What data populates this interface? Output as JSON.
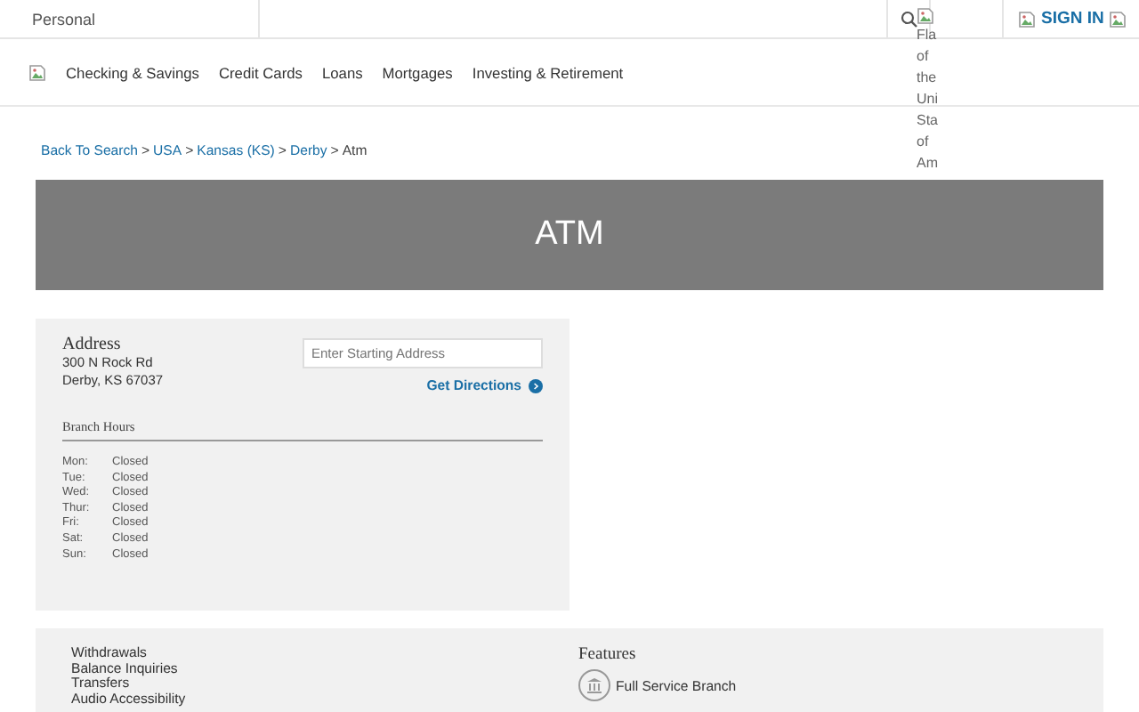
{
  "top_bar": {
    "segment": "Personal",
    "flag_alt_lines": [
      "Fla",
      "of",
      "the",
      "Uni",
      "Sta",
      "of",
      "Am"
    ],
    "sign_in": "SIGN IN"
  },
  "nav": {
    "items": [
      "Checking & Savings",
      "Credit Cards",
      "Loans",
      "Mortgages",
      "Investing & Retirement"
    ]
  },
  "breadcrumb": {
    "items": [
      {
        "kind": "link",
        "text": "Back To Search"
      },
      {
        "kind": "separator",
        "text": ">"
      },
      {
        "kind": "link",
        "text": "USA"
      },
      {
        "kind": "separator",
        "text": ">"
      },
      {
        "kind": "link",
        "text": "Kansas (KS)"
      },
      {
        "kind": "separator",
        "text": ">"
      },
      {
        "kind": "link",
        "text": "Derby"
      },
      {
        "kind": "separator",
        "text": ">"
      },
      {
        "kind": "current",
        "text": "Atm"
      }
    ]
  },
  "banner": {
    "title": "ATM"
  },
  "location": {
    "address_heading": "Address",
    "address_lines": [
      "300 N Rock Rd",
      "Derby, KS 67037"
    ],
    "start_placeholder": "Enter Starting Address",
    "directions": "Get Directions",
    "hours_heading": "Branch Hours",
    "hours": [
      {
        "day": "Mon:",
        "time": "Closed"
      },
      {
        "day": "Tue:",
        "time": "Closed"
      },
      {
        "day": "Wed:",
        "time": "Closed"
      },
      {
        "day": "Thur:",
        "time": "Closed"
      },
      {
        "day": "Fri:",
        "time": "Closed"
      },
      {
        "day": "Sat:",
        "time": "Closed"
      },
      {
        "day": "Sun:",
        "time": "Closed"
      }
    ]
  },
  "services": {
    "items": [
      "Withdrawals",
      "Balance Inquiries",
      "Transfers",
      "Audio Accessibility"
    ],
    "features_heading": "Features",
    "features": [
      "Full Service Branch"
    ]
  }
}
